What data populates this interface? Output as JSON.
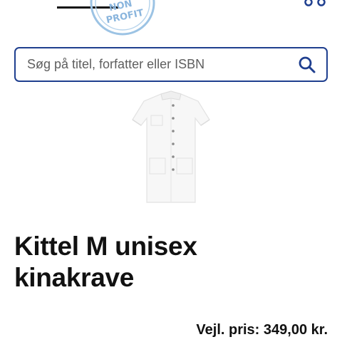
{
  "header": {
    "badge_text_top": "NON",
    "badge_text_bottom": "PROFIT",
    "badge_color": "#1e73b8",
    "menu_icon": "three-dots-icon"
  },
  "search": {
    "placeholder": "Søg på titel, forfatter eller ISBN",
    "value": "",
    "icon": "search-icon",
    "border_color": "#1f3f8f"
  },
  "product": {
    "image_icon": "white-coat-image",
    "title_line1": "Kittel M unisex",
    "title_line2": "kinakrave",
    "price_label": "Vejl. pris:",
    "price_value": "349,00 kr."
  }
}
